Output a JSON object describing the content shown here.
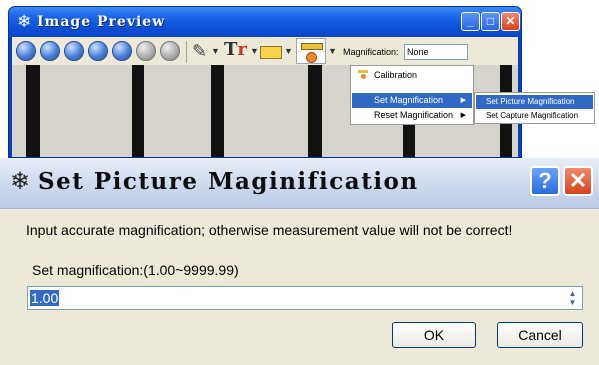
{
  "preview_window": {
    "title": "Image Preview",
    "magnification_label": "Magnification:",
    "magnification_value": "None"
  },
  "menu": {
    "items": [
      {
        "label": "Calibration"
      },
      {
        "label": "Set Magnification"
      },
      {
        "label": "Reset Magnification"
      }
    ],
    "submenu": [
      {
        "label": "Set Picture Magnification"
      },
      {
        "label": "Set Capture Magnification"
      }
    ]
  },
  "dialog": {
    "title": "Set Picture Maginification",
    "message": "Input accurate magnification; otherwise measurement value will not be correct!",
    "range_label": "Set magnification:(1.00~9999.99)",
    "value": "1.00",
    "ok_label": "OK",
    "cancel_label": "Cancel"
  },
  "colors": {
    "xp_titlebar": "#0d4fd6",
    "menu_highlight": "#316ac5",
    "dialog_bg": "#ece9d8"
  }
}
